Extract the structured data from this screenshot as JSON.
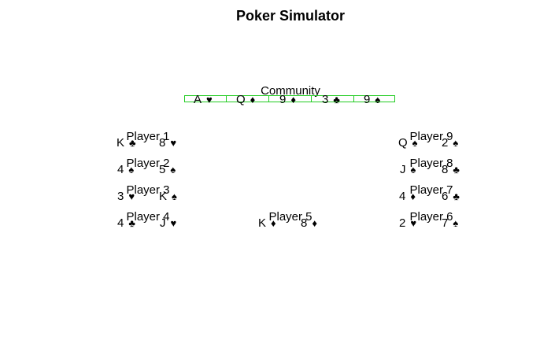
{
  "title": "Poker Simulator",
  "community": {
    "label": "Community",
    "cards": [
      {
        "rank": "A",
        "suit": "♥"
      },
      {
        "rank": "Q",
        "suit": "♦"
      },
      {
        "rank": "9",
        "suit": "♦"
      },
      {
        "rank": "3",
        "suit": "♣"
      },
      {
        "rank": "9",
        "suit": "♠"
      }
    ]
  },
  "players": [
    {
      "name": "Player 1",
      "cards": [
        {
          "rank": "K",
          "suit": "♣"
        },
        {
          "rank": "8",
          "suit": "♥"
        }
      ]
    },
    {
      "name": "Player 2",
      "cards": [
        {
          "rank": "4",
          "suit": "♠"
        },
        {
          "rank": "5",
          "suit": "♠"
        }
      ]
    },
    {
      "name": "Player 3",
      "cards": [
        {
          "rank": "3",
          "suit": "♥"
        },
        {
          "rank": "K",
          "suit": "♠"
        }
      ]
    },
    {
      "name": "Player 4",
      "cards": [
        {
          "rank": "4",
          "suit": "♣"
        },
        {
          "rank": "J",
          "suit": "♥"
        }
      ]
    },
    {
      "name": "Player 5",
      "cards": [
        {
          "rank": "K",
          "suit": "♦"
        },
        {
          "rank": "8",
          "suit": "♦"
        }
      ]
    },
    {
      "name": "Player 6",
      "cards": [
        {
          "rank": "2",
          "suit": "♥"
        },
        {
          "rank": "7",
          "suit": "♠"
        }
      ]
    },
    {
      "name": "Player 7",
      "cards": [
        {
          "rank": "4",
          "suit": "♦"
        },
        {
          "rank": "6",
          "suit": "♣"
        }
      ]
    },
    {
      "name": "Player 8",
      "cards": [
        {
          "rank": "J",
          "suit": "♠"
        },
        {
          "rank": "8",
          "suit": "♣"
        }
      ]
    },
    {
      "name": "Player 9",
      "cards": [
        {
          "rank": "Q",
          "suit": "♠"
        },
        {
          "rank": "2",
          "suit": "♠"
        }
      ]
    }
  ]
}
